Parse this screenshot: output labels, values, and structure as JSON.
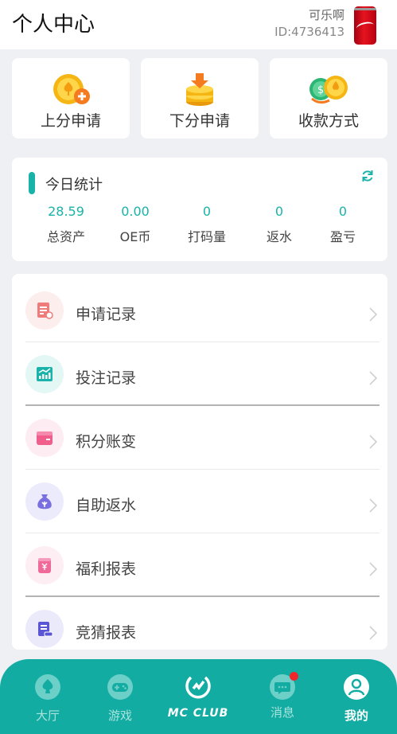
{
  "header": {
    "title": "个人中心",
    "username": "可乐啊",
    "user_id": "ID:4736413"
  },
  "quick_actions": [
    {
      "label": "上分申请",
      "icon": "gold-coin-plus-icon"
    },
    {
      "label": "下分申请",
      "icon": "coin-stack-arrow-icon"
    },
    {
      "label": "收款方式",
      "icon": "coins-payment-icon"
    }
  ],
  "stats": {
    "title": "今日统计",
    "items": [
      {
        "value": "28.59",
        "label": "总资产"
      },
      {
        "value": "0.00",
        "label": "OE币"
      },
      {
        "value": "0",
        "label": "打码量"
      },
      {
        "value": "0",
        "label": "返水"
      },
      {
        "value": "0",
        "label": "盈亏"
      }
    ]
  },
  "menu": [
    {
      "label": "申请记录",
      "icon": "document-edit-icon",
      "color": "#f07b7b",
      "bg": "#fdeeee"
    },
    {
      "label": "投注记录",
      "icon": "chart-trend-icon",
      "color": "#19b3aa",
      "bg": "#e3f7f5"
    },
    {
      "label": "积分账变",
      "icon": "wallet-icon",
      "color": "#f05e8c",
      "bg": "#fdecf2"
    },
    {
      "label": "自助返水",
      "icon": "money-bag-icon",
      "color": "#7a6fe0",
      "bg": "#ecebfb"
    },
    {
      "label": "福利报表",
      "icon": "yen-coupon-icon",
      "color": "#ef6a98",
      "bg": "#fdeef4"
    },
    {
      "label": "竞猜报表",
      "icon": "list-report-icon",
      "color": "#5a55d6",
      "bg": "#ebeafb"
    }
  ],
  "tabbar": [
    {
      "label": "大厅",
      "icon": "spade-icon"
    },
    {
      "label": "游戏",
      "icon": "gamepad-icon"
    },
    {
      "label": "MC CLUB",
      "icon": "mc-club-logo-icon"
    },
    {
      "label": "消息",
      "icon": "message-icon"
    },
    {
      "label": "我的",
      "icon": "user-profile-icon"
    }
  ],
  "colors": {
    "accent": "#19b3aa",
    "tabbar": "#13aca2",
    "notification": "#f0262a"
  }
}
